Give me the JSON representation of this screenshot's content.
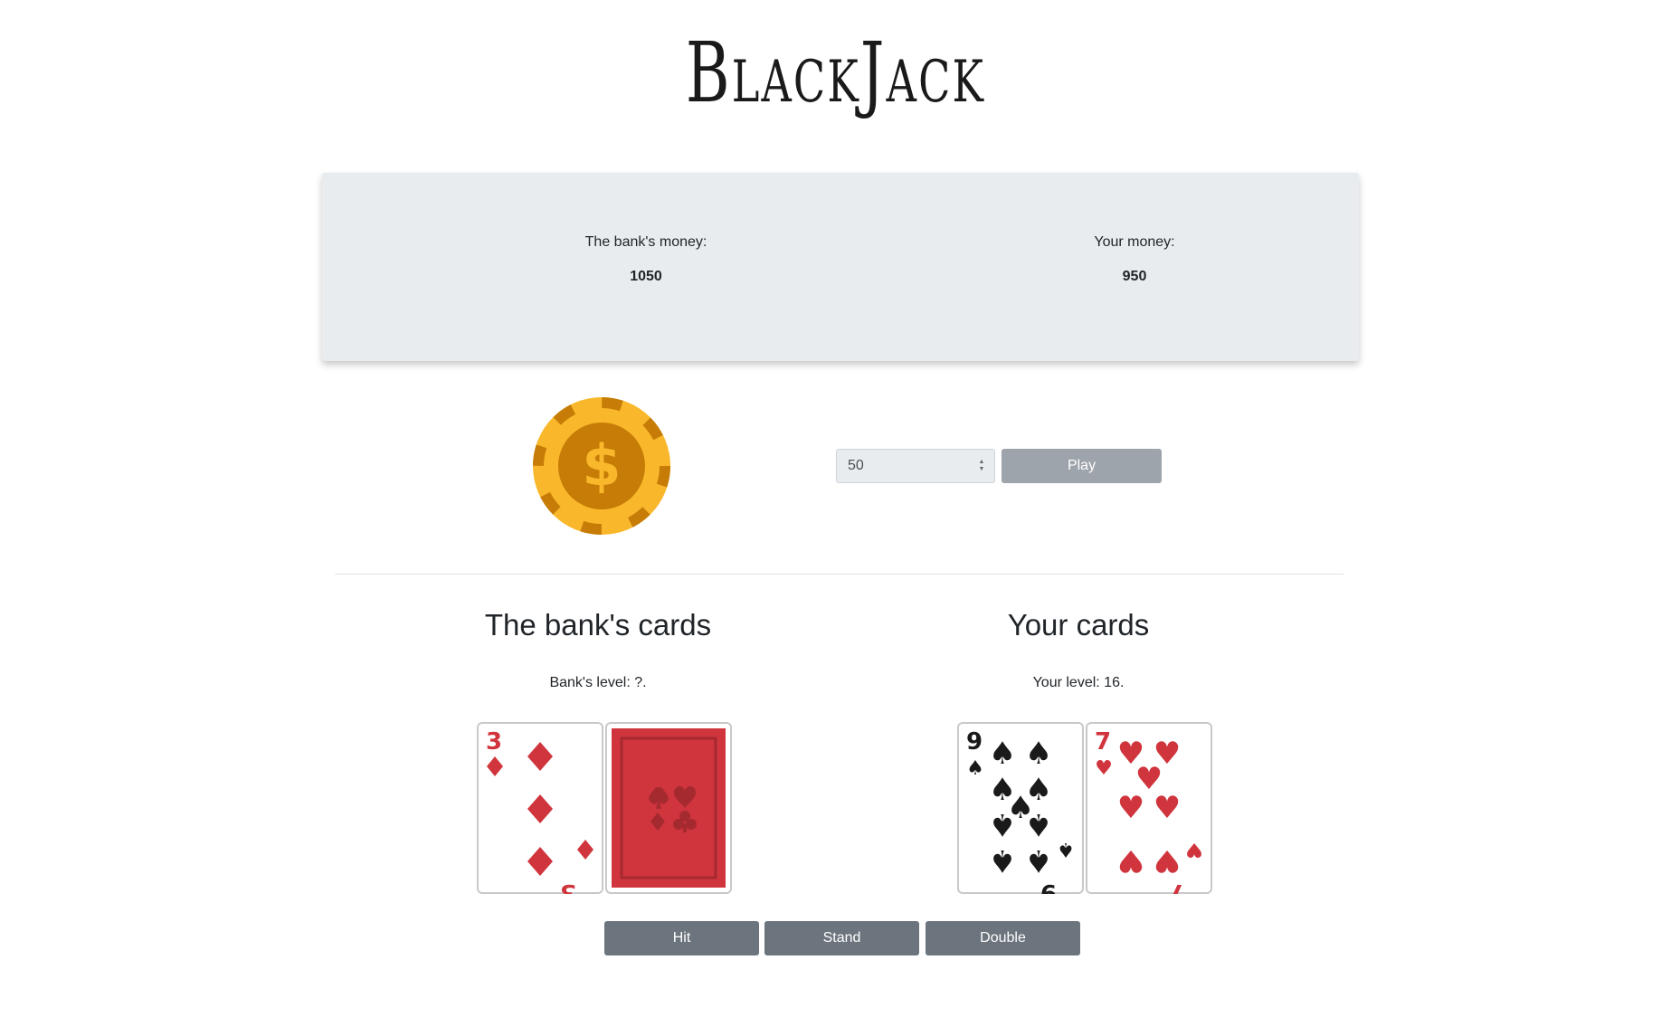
{
  "title": "BlackJack",
  "money": {
    "bank_label": "The bank's money:",
    "bank_value": "1050",
    "player_label": "Your money:",
    "player_value": "950"
  },
  "bet": {
    "value": "50",
    "play_label": "Play"
  },
  "bank": {
    "heading": "The bank's cards",
    "level": "Bank's level: ?.",
    "cards": [
      {
        "rank": "3",
        "suit": "diamonds",
        "face_up": true
      },
      {
        "face_up": false
      }
    ]
  },
  "player": {
    "heading": "Your cards",
    "level": "Your level: 16.",
    "cards": [
      {
        "rank": "9",
        "suit": "spades",
        "face_up": true
      },
      {
        "rank": "7",
        "suit": "hearts",
        "face_up": true
      }
    ]
  },
  "actions": {
    "hit": "Hit",
    "stand": "Stand",
    "double": "Double"
  },
  "colors": {
    "red_suit": "#d0353d",
    "black_suit": "#1a1a1a",
    "chip_gold": "#f9b82b",
    "chip_dark": "#c67c06",
    "button_gray": "#6c757d"
  }
}
